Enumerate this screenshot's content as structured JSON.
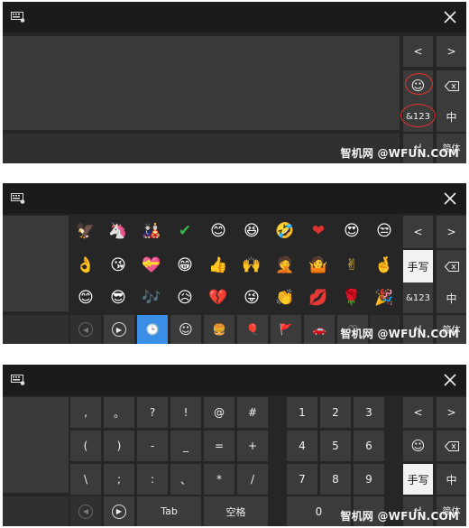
{
  "watermark": "智机网 @WFUN.COM",
  "common": {
    "left_arrow": "<",
    "right_arrow": ">",
    "close": "✕",
    "symbols": "&123",
    "zh": "中",
    "simplified": "简体",
    "handwrite": "手写",
    "enter": "↵"
  },
  "emoji_rows": [
    [
      "🦅",
      "🦄",
      "🎎",
      "✔",
      "😊",
      "😆",
      "🤣",
      "❤",
      "😍",
      "😒"
    ],
    [
      "👌",
      "😘",
      "💝",
      "😁",
      "👍",
      "🙌",
      "🤦",
      "🤷",
      "✌",
      "🤞"
    ],
    [
      "😊",
      "😎",
      "🎶",
      "😥",
      "💔",
      "😜",
      "👏",
      "💋",
      "🌹",
      "🎉"
    ]
  ],
  "emoji_categories": [
    "◀",
    "▶",
    "🕒",
    "☺",
    "🍔",
    "🎈",
    "🚩",
    "🚗",
    "♡"
  ],
  "symbol_rows": [
    [
      ",",
      "。",
      "?",
      "!",
      "@",
      "#"
    ],
    [
      "(",
      ")",
      "-",
      "_",
      "=",
      "+"
    ],
    [
      "\\",
      ";",
      ":",
      "、",
      "*",
      "/"
    ]
  ],
  "numpad_rows": [
    [
      "1",
      "2",
      "3"
    ],
    [
      "4",
      "5",
      "6"
    ],
    [
      "7",
      "8",
      "9"
    ]
  ],
  "bottom_row": {
    "tab": "Tab",
    "space": "空格",
    "zero": "0"
  },
  "accent_color": "#3a8ee6",
  "annotation_color": "#e0322f"
}
